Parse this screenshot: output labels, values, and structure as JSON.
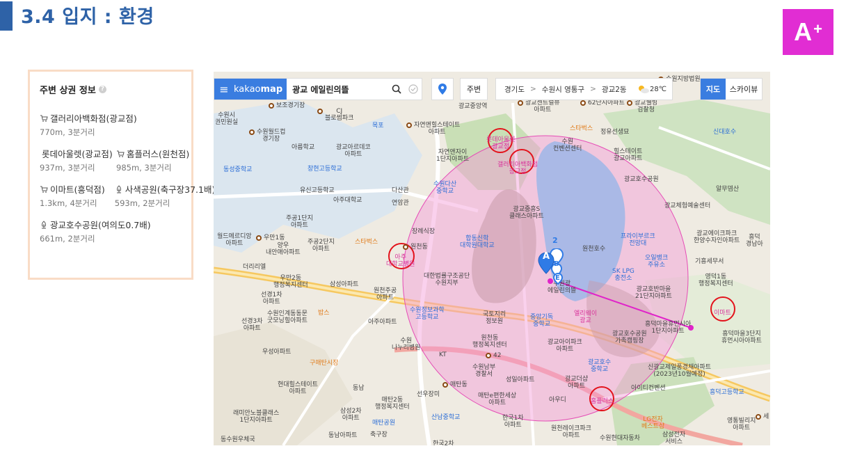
{
  "title": "3.4 입지 : 환경",
  "grade": {
    "letter": "A",
    "suffix": "+"
  },
  "info_panel": {
    "heading": "주변 상권 정보",
    "help": "?",
    "rows": [
      [
        {
          "icon": "cart-icon",
          "name": "갤러리아백화점(광교점)",
          "sub": "770m, 3분거리"
        }
      ],
      [
        {
          "icon": "cart-icon",
          "name": "롯데아울렛(광교점)",
          "sub": "937m, 3분거리"
        },
        {
          "icon": "cart-icon",
          "name": "홈플러스(원천점)",
          "sub": "985m, 3분거리"
        }
      ],
      [
        {
          "icon": "cart-icon",
          "name": "이마트(흥덕점)",
          "sub": "1.3km, 4분거리"
        },
        {
          "icon": "tree-icon",
          "name": "사색공원(축구장37.1배)",
          "sub": "593m, 2분거리"
        }
      ],
      [
        {
          "icon": "tree-icon",
          "name": "광교호수공원(여의도0.7배)",
          "sub": "661m, 2분거리"
        }
      ]
    ]
  },
  "map": {
    "menu": "≡",
    "logo_a": "kakao",
    "logo_b": "map",
    "query": "광교 에일린의뜰",
    "around": "주변",
    "crumbs": [
      "경기도",
      "수원시 영통구",
      "광교2동"
    ],
    "crumb_sep": ">",
    "temperature": "28℃",
    "maptype_on": "지도",
    "maptype_off": "스카이뷰",
    "pin_a": "A",
    "pin_b": "B",
    "pin_2": "2",
    "pin_e": "E",
    "labels": {
      "l1": "보조경기장",
      "l2": "CJ\n블로썸파크",
      "l3": "수원시\n권민원실",
      "l4": "목포",
      "l5": "수원월드컵\n경기장",
      "l6": "자연앤힐스테이트\n아파트",
      "l7": "광교센트럴뷰\n아파트",
      "l8": "62단지아파트",
      "l9": "광교웰빙\n검찰청",
      "l10": "스타벅스",
      "l11": "정유선생묘",
      "l12": "수원\n컨벤션센터",
      "l13": "힐스테이트\n광교아파트",
      "l14": "신대호수",
      "l15": "광교중앙역",
      "l16": "아름학교",
      "l17": "광교아르데코\n아파트",
      "l18": "자연앤자이\n1단지아파트",
      "l19": "동성중학교",
      "l20": "창현고등학교",
      "l21": "광교호수공원",
      "l22": "수원다산\n중학교",
      "l23": "유신고등학교",
      "l24": "아주대학교",
      "l25": "다산관",
      "l26": "연암관",
      "l27": "광교중흥S\n클래스아파트",
      "l28": "광교체험예술센터",
      "l29": "알무뎀산",
      "l30": "주공1단지\n아파트",
      "l31": "장례식장",
      "l32": "광교에이크파크\n한양수자인아파트",
      "l33": "흥덕\n경남아",
      "l34": "월드메르디앙\n아파트",
      "l35": "주공2단지\n아파트",
      "l36": "스타벅스",
      "l37": "합동신학\n대학원대학교",
      "l38": "원천호수",
      "l39": "프라이부르크\n전망대",
      "l40": "오일뱅크\n주유소",
      "l41": "기흥세무서",
      "l42": "양우\n내안애아파트",
      "l43": "더리리엘",
      "l44": "아주\n대학교병원",
      "l45": "수원광\n에일린의뜰",
      "l46": "SK LPG\n충전소",
      "l47": "영덕1동\n행정복지센터",
      "l48": "우만2동\n행정복지센터",
      "l49": "삼성아파트",
      "l50": "대한법률구조공단\n수원지부",
      "l51": "광교호반마을\n21단지아파트",
      "l52": "선경1차\n아파트",
      "l53": "원천주공\n아파트",
      "l54": "수원인계동동문\n굿모닝힐아파트",
      "l55": "밥스",
      "l56": "수원정보과학\n고등학교",
      "l57": "국토지리\n정보원",
      "l58": "중앙기독\n중학교",
      "l59": "엘리웨이\n광교",
      "l60": "이마트",
      "l61": "흥덕마을3단지\n휴먼시아아파트",
      "l62": "선경3차\n아파트",
      "l63": "아주아파트",
      "l64": "수원\n나누리병원",
      "l65": "원천동\n행정복지센터",
      "l66": "광교아이파크\n아파트",
      "l67": "광교호수공원\n가족캠핑장",
      "l68": "흥덕마을휴먼시아\n1단지아파트",
      "l69": "우성아파트",
      "l70": "구매탄시장",
      "l71": "KT",
      "l72": "수원남부\n경찰서",
      "l73": "광교호수\n중학교",
      "l74": "신광교제일풍경채아파트\n(2023년10월예정)",
      "l75": "현대힐스테이트\n아파트",
      "l76": "동남",
      "l77": "성일아파트",
      "l78": "광교더샵\n아파트",
      "l79": "아이티컨벤션",
      "l80": "흥덕고등학교",
      "l81": "매탄2동\n행정복지센터",
      "l82": "선우장미",
      "l83": "매탄e편한세상\n아파트",
      "l84": "아우디",
      "l85": "홈플러스",
      "l86": "래미안노블클래스\n1단지아파트",
      "l87": "삼성2차\n아파트",
      "l88": "매탄공원",
      "l89": "산남중학교",
      "l90": "한국1차\n아파트",
      "l91": "LG전자\n베스트샵",
      "l92": "영통빌리지\n아파트",
      "l93": "동수원우체국",
      "l94": "동남아파트",
      "l95": "축구장",
      "l96": "한국2차",
      "l97": "원천레이크파크\n아파트",
      "l98": "수원현대자동차",
      "l99": "삼성전자\n서비스",
      "l100": "롯데아울렛\n광교점",
      "l101": "갤러리아백화점\n광교점",
      "l102": "매탄동",
      "l103": "원천동",
      "l104": "우만1동",
      "l105": "수원지방법원",
      "l106": "42",
      "l107": "세"
    }
  }
}
